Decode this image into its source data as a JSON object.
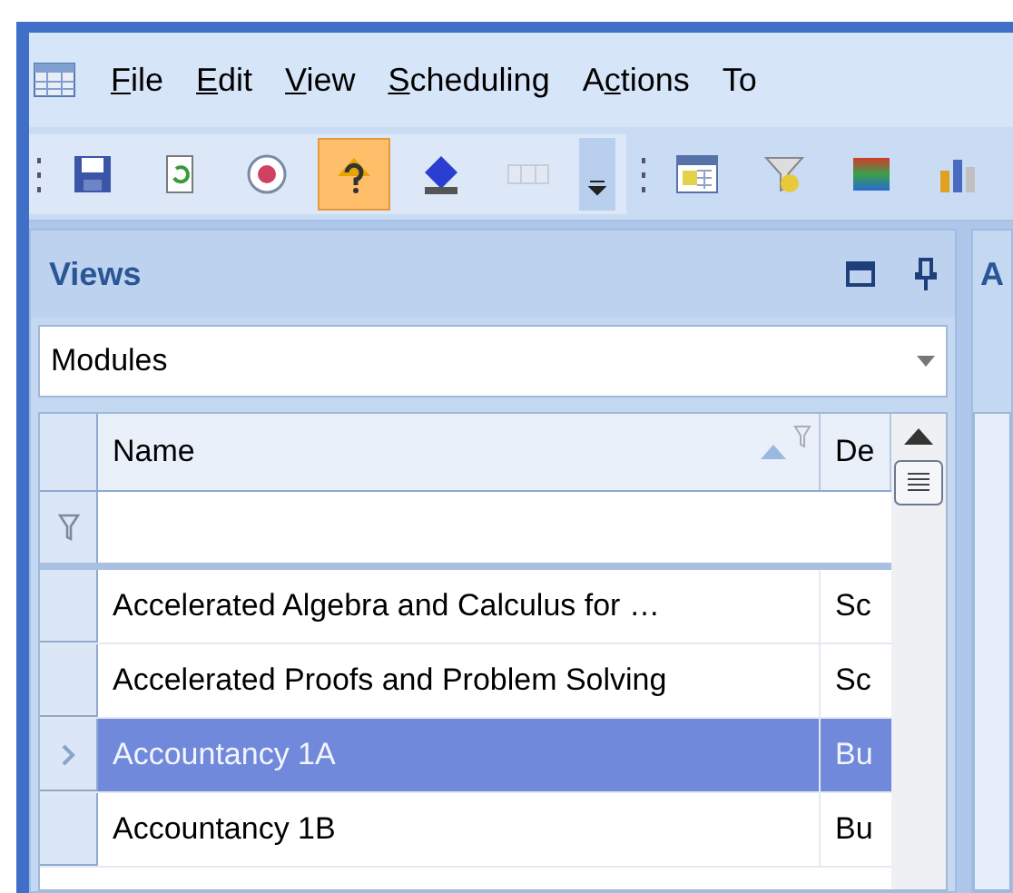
{
  "menu": [
    {
      "key": "F",
      "post": "ile"
    },
    {
      "key": "E",
      "post": "dit"
    },
    {
      "key": "V",
      "post": "iew"
    },
    {
      "key": "S",
      "post": "cheduling"
    },
    {
      "pre": "A",
      "key": "c",
      "post": "tions"
    },
    {
      "pre": "To"
    }
  ],
  "toolbars": [
    [
      {
        "kind": "save",
        "hot": false,
        "disabled": false
      },
      {
        "kind": "refresh",
        "hot": false,
        "disabled": false
      },
      {
        "kind": "badge",
        "hot": false,
        "disabled": false
      },
      {
        "kind": "help",
        "hot": true,
        "disabled": false
      },
      {
        "kind": "diamond",
        "hot": false,
        "disabled": false
      },
      {
        "kind": "columns",
        "hot": false,
        "disabled": true
      }
    ],
    [
      {
        "kind": "calendar",
        "hot": false,
        "disabled": false
      },
      {
        "kind": "filter",
        "hot": false,
        "disabled": false
      },
      {
        "kind": "gradient",
        "hot": false,
        "disabled": false
      },
      {
        "kind": "chart",
        "hot": false,
        "disabled": false
      }
    ]
  ],
  "views_panel": {
    "title": "Views",
    "dropdown": {
      "value": "Modules"
    },
    "grid": {
      "columns": [
        "Name",
        "De"
      ],
      "rows": [
        {
          "cells": [
            "Accelerated Algebra and Calculus for …",
            "Sc"
          ],
          "selected": false
        },
        {
          "cells": [
            "Accelerated Proofs and Problem Solving",
            "Sc"
          ],
          "selected": false
        },
        {
          "cells": [
            "Accountancy 1A",
            "Bu"
          ],
          "selected": true
        },
        {
          "cells": [
            "Accountancy 1B",
            "Bu"
          ],
          "selected": false
        }
      ]
    }
  },
  "second_panel": {
    "title": "A"
  }
}
